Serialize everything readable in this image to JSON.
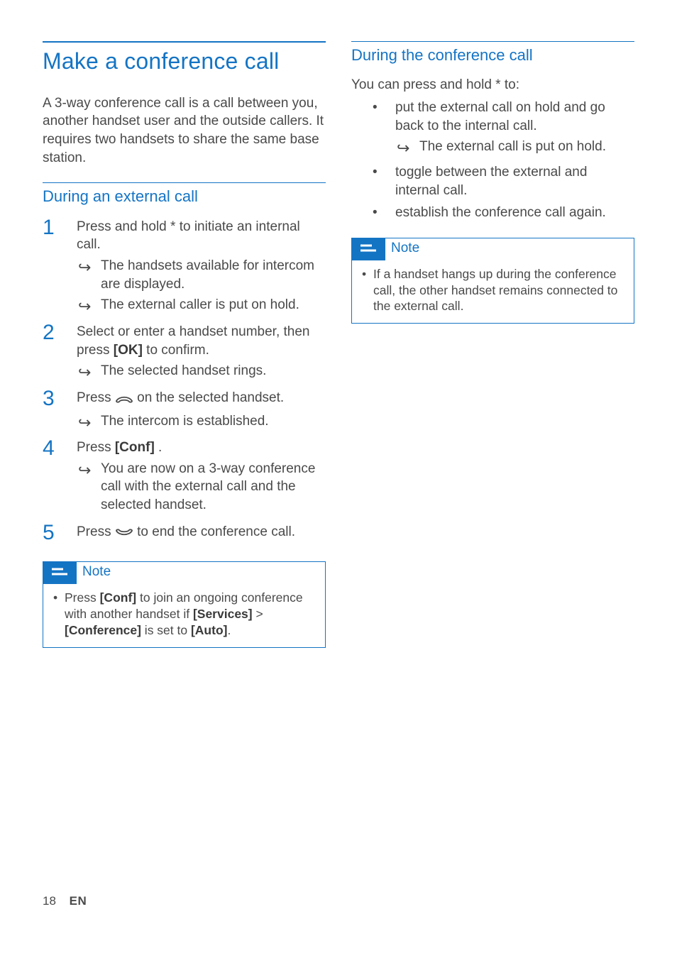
{
  "left": {
    "h1": "Make a conference call",
    "intro": "A 3-way conference call is a call between you, another handset user and the outside callers. It requires two handsets to share the same base station.",
    "h2": "During an external call",
    "steps": {
      "s1": {
        "text": "Press and hold * to initiate an internal call.",
        "r1": "The handsets available for intercom are displayed.",
        "r2": "The external caller is put on hold."
      },
      "s2": {
        "t1": "Select or enter a handset number, then press ",
        "ok": "[OK]",
        "t2": " to confirm.",
        "r1": "The selected handset rings."
      },
      "s3": {
        "t1": "Press ",
        "t2": " on the selected handset.",
        "r1": "The intercom is established."
      },
      "s4": {
        "t1": "Press ",
        "conf": "[Conf]",
        "t2": " .",
        "r1": "You are now on a 3-way conference call with the external call and the selected handset."
      },
      "s5": {
        "t1": "Press ",
        "t2": " to end the conference call."
      }
    },
    "note": {
      "title": "Note",
      "t1": "Press ",
      "conf": "[Conf]",
      "t2": " to join an ongoing conference with another handset if ",
      "services": "[Services]",
      "gt": " > ",
      "conference": "[Conference]",
      "t3": " is set to ",
      "auto": "[Auto]",
      "t4": "."
    }
  },
  "right": {
    "h2": "During the conference call",
    "lead": "You can press and hold * to:",
    "b1": "put the external call on hold and go back to the internal call.",
    "b1r": "The external call is put on hold.",
    "b2": "toggle between the external and internal call.",
    "b3": "establish the conference call again.",
    "note": {
      "title": "Note",
      "item": "If a handset hangs up during the conference call, the other handset remains connected to the external call."
    }
  },
  "footer": {
    "page": "18",
    "lang": "EN"
  }
}
